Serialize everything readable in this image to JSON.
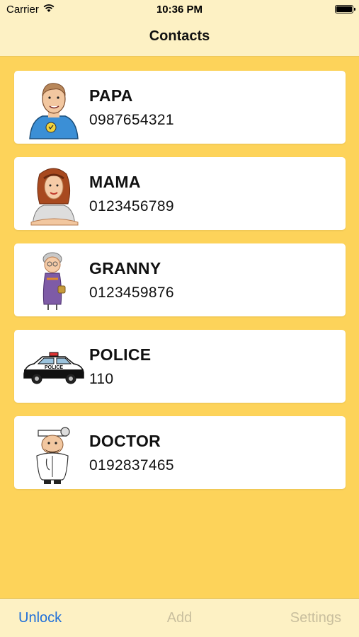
{
  "status_bar": {
    "carrier": "Carrier",
    "time": "10:36 PM",
    "wifi_icon": "wifi-icon",
    "battery_icon": "battery-icon"
  },
  "nav": {
    "title": "Contacts"
  },
  "contacts": [
    {
      "name": "PAPA",
      "phone": "0987654321",
      "avatar": "father-cartoon"
    },
    {
      "name": "MAMA",
      "phone": "0123456789",
      "avatar": "mother-cartoon"
    },
    {
      "name": "GRANNY",
      "phone": "0123459876",
      "avatar": "grandmother-cartoon"
    },
    {
      "name": "POLICE",
      "phone": "110",
      "avatar": "police-car-cartoon"
    },
    {
      "name": "DOCTOR",
      "phone": "0192837465",
      "avatar": "doctor-cartoon"
    }
  ],
  "tab_bar": {
    "unlock": "Unlock",
    "add": "Add",
    "settings": "Settings"
  },
  "colors": {
    "background": "#FDD35A",
    "bars": "#FDF1C4",
    "active_tab": "#1E6FD9",
    "inactive_tab": "#C9BF9E"
  }
}
